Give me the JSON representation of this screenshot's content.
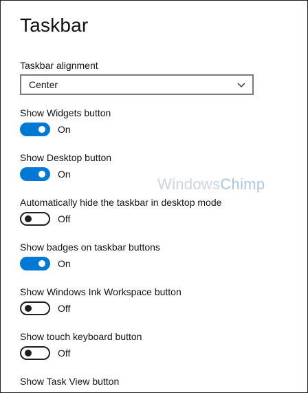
{
  "page": {
    "title": "Taskbar"
  },
  "alignment": {
    "label": "Taskbar alignment",
    "selected": "Center",
    "icon": "chevron-down-icon"
  },
  "settings": [
    {
      "label": "Show Widgets button",
      "state": "On",
      "on": true
    },
    {
      "label": "Show Desktop button",
      "state": "On",
      "on": true
    },
    {
      "label": "Automatically hide the taskbar in desktop mode",
      "state": "Off",
      "on": false
    },
    {
      "label": "Show badges on taskbar buttons",
      "state": "On",
      "on": true
    },
    {
      "label": "Show Windows Ink Workspace button",
      "state": "Off",
      "on": false
    },
    {
      "label": "Show touch keyboard button",
      "state": "Off",
      "on": false
    },
    {
      "label": "Show Task View button"
    }
  ],
  "watermark": {
    "part1": "Windows",
    "part2": "Chimp"
  },
  "colors": {
    "accent": "#0078d4",
    "toggle_off_border": "#1f1f1f",
    "dropdown_border": "#7a7a7a"
  }
}
